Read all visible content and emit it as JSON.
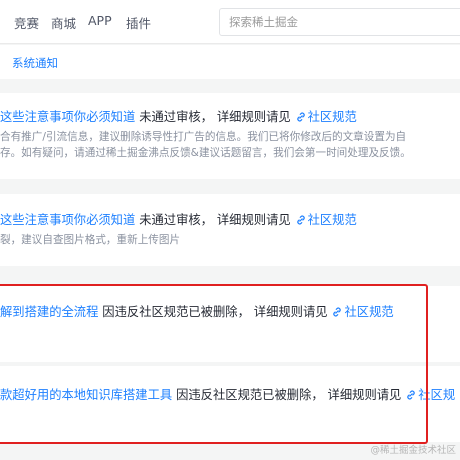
{
  "nav": {
    "items": [
      {
        "label": "竞赛"
      },
      {
        "label": "商城"
      },
      {
        "label": "APP"
      },
      {
        "label": "插件"
      }
    ],
    "search_placeholder": "探索稀土掘金"
  },
  "subnav": {
    "active_tab": "系统通知"
  },
  "notifications": [
    {
      "title": "这些注意事项你必须知道",
      "status": " 未通过审核， 详细规则请见 ",
      "link": "社区规范",
      "desc": [
        "合有推广/引流信息，建议删除诱导性打广告的信息。我们已将你修改后的文章设置为自",
        "存。如有疑问，请通过稀土掘金沸点反馈&建议话题留言，我们会第一时间处理及反馈。"
      ]
    },
    {
      "title": "这些注意事项你必须知道",
      "status": " 未通过审核， 详细规则请见 ",
      "link": "社区规范",
      "desc": [
        "裂，建议自查图片格式，重新上传图片"
      ]
    },
    {
      "title": "解到搭建的全流程",
      "status": " 因违反社区规范已被删除， 详细规则请见 ",
      "link": "社区规范",
      "desc": []
    },
    {
      "title": "款超好用的本地知识库搭建工具",
      "status": " 因违反社区规范已被删除， 详细规则请见 ",
      "link": "社区规",
      "desc": []
    }
  ],
  "watermark": "@稀土掘金技术社区",
  "colors": {
    "link": "#1e80ff",
    "highlight": "#e02020",
    "muted": "#8a919f"
  }
}
